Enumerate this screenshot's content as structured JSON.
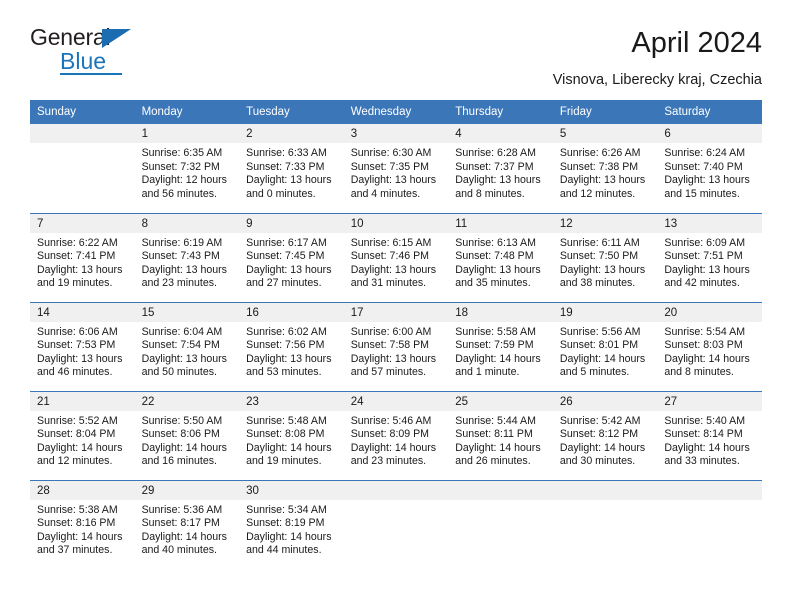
{
  "logo": {
    "text_primary": "General",
    "text_secondary": "Blue",
    "triangle_icon": "blue-triangle-icon",
    "brand_color": "#1b75bb"
  },
  "header": {
    "title": "April 2024",
    "location": "Visnova, Liberecky kraj, Czechia",
    "header_bg_color": "#3b76b8",
    "daynum_bg_color": "#f0f0f0"
  },
  "weekdays": [
    "Sunday",
    "Monday",
    "Tuesday",
    "Wednesday",
    "Thursday",
    "Friday",
    "Saturday"
  ],
  "labels": {
    "sunrise_prefix": "Sunrise:",
    "sunset_prefix": "Sunset:",
    "daylight_prefix": "Daylight:"
  },
  "weeks": [
    [
      {
        "empty": true
      },
      {
        "day": "1",
        "sunrise": "Sunrise: 6:35 AM",
        "sunset": "Sunset: 7:32 PM",
        "daylight_line1": "Daylight: 12 hours",
        "daylight_line2": "and 56 minutes."
      },
      {
        "day": "2",
        "sunrise": "Sunrise: 6:33 AM",
        "sunset": "Sunset: 7:33 PM",
        "daylight_line1": "Daylight: 13 hours",
        "daylight_line2": "and 0 minutes."
      },
      {
        "day": "3",
        "sunrise": "Sunrise: 6:30 AM",
        "sunset": "Sunset: 7:35 PM",
        "daylight_line1": "Daylight: 13 hours",
        "daylight_line2": "and 4 minutes."
      },
      {
        "day": "4",
        "sunrise": "Sunrise: 6:28 AM",
        "sunset": "Sunset: 7:37 PM",
        "daylight_line1": "Daylight: 13 hours",
        "daylight_line2": "and 8 minutes."
      },
      {
        "day": "5",
        "sunrise": "Sunrise: 6:26 AM",
        "sunset": "Sunset: 7:38 PM",
        "daylight_line1": "Daylight: 13 hours",
        "daylight_line2": "and 12 minutes."
      },
      {
        "day": "6",
        "sunrise": "Sunrise: 6:24 AM",
        "sunset": "Sunset: 7:40 PM",
        "daylight_line1": "Daylight: 13 hours",
        "daylight_line2": "and 15 minutes."
      }
    ],
    [
      {
        "day": "7",
        "sunrise": "Sunrise: 6:22 AM",
        "sunset": "Sunset: 7:41 PM",
        "daylight_line1": "Daylight: 13 hours",
        "daylight_line2": "and 19 minutes."
      },
      {
        "day": "8",
        "sunrise": "Sunrise: 6:19 AM",
        "sunset": "Sunset: 7:43 PM",
        "daylight_line1": "Daylight: 13 hours",
        "daylight_line2": "and 23 minutes."
      },
      {
        "day": "9",
        "sunrise": "Sunrise: 6:17 AM",
        "sunset": "Sunset: 7:45 PM",
        "daylight_line1": "Daylight: 13 hours",
        "daylight_line2": "and 27 minutes."
      },
      {
        "day": "10",
        "sunrise": "Sunrise: 6:15 AM",
        "sunset": "Sunset: 7:46 PM",
        "daylight_line1": "Daylight: 13 hours",
        "daylight_line2": "and 31 minutes."
      },
      {
        "day": "11",
        "sunrise": "Sunrise: 6:13 AM",
        "sunset": "Sunset: 7:48 PM",
        "daylight_line1": "Daylight: 13 hours",
        "daylight_line2": "and 35 minutes."
      },
      {
        "day": "12",
        "sunrise": "Sunrise: 6:11 AM",
        "sunset": "Sunset: 7:50 PM",
        "daylight_line1": "Daylight: 13 hours",
        "daylight_line2": "and 38 minutes."
      },
      {
        "day": "13",
        "sunrise": "Sunrise: 6:09 AM",
        "sunset": "Sunset: 7:51 PM",
        "daylight_line1": "Daylight: 13 hours",
        "daylight_line2": "and 42 minutes."
      }
    ],
    [
      {
        "day": "14",
        "sunrise": "Sunrise: 6:06 AM",
        "sunset": "Sunset: 7:53 PM",
        "daylight_line1": "Daylight: 13 hours",
        "daylight_line2": "and 46 minutes."
      },
      {
        "day": "15",
        "sunrise": "Sunrise: 6:04 AM",
        "sunset": "Sunset: 7:54 PM",
        "daylight_line1": "Daylight: 13 hours",
        "daylight_line2": "and 50 minutes."
      },
      {
        "day": "16",
        "sunrise": "Sunrise: 6:02 AM",
        "sunset": "Sunset: 7:56 PM",
        "daylight_line1": "Daylight: 13 hours",
        "daylight_line2": "and 53 minutes."
      },
      {
        "day": "17",
        "sunrise": "Sunrise: 6:00 AM",
        "sunset": "Sunset: 7:58 PM",
        "daylight_line1": "Daylight: 13 hours",
        "daylight_line2": "and 57 minutes."
      },
      {
        "day": "18",
        "sunrise": "Sunrise: 5:58 AM",
        "sunset": "Sunset: 7:59 PM",
        "daylight_line1": "Daylight: 14 hours",
        "daylight_line2": "and 1 minute."
      },
      {
        "day": "19",
        "sunrise": "Sunrise: 5:56 AM",
        "sunset": "Sunset: 8:01 PM",
        "daylight_line1": "Daylight: 14 hours",
        "daylight_line2": "and 5 minutes."
      },
      {
        "day": "20",
        "sunrise": "Sunrise: 5:54 AM",
        "sunset": "Sunset: 8:03 PM",
        "daylight_line1": "Daylight: 14 hours",
        "daylight_line2": "and 8 minutes."
      }
    ],
    [
      {
        "day": "21",
        "sunrise": "Sunrise: 5:52 AM",
        "sunset": "Sunset: 8:04 PM",
        "daylight_line1": "Daylight: 14 hours",
        "daylight_line2": "and 12 minutes."
      },
      {
        "day": "22",
        "sunrise": "Sunrise: 5:50 AM",
        "sunset": "Sunset: 8:06 PM",
        "daylight_line1": "Daylight: 14 hours",
        "daylight_line2": "and 16 minutes."
      },
      {
        "day": "23",
        "sunrise": "Sunrise: 5:48 AM",
        "sunset": "Sunset: 8:08 PM",
        "daylight_line1": "Daylight: 14 hours",
        "daylight_line2": "and 19 minutes."
      },
      {
        "day": "24",
        "sunrise": "Sunrise: 5:46 AM",
        "sunset": "Sunset: 8:09 PM",
        "daylight_line1": "Daylight: 14 hours",
        "daylight_line2": "and 23 minutes."
      },
      {
        "day": "25",
        "sunrise": "Sunrise: 5:44 AM",
        "sunset": "Sunset: 8:11 PM",
        "daylight_line1": "Daylight: 14 hours",
        "daylight_line2": "and 26 minutes."
      },
      {
        "day": "26",
        "sunrise": "Sunrise: 5:42 AM",
        "sunset": "Sunset: 8:12 PM",
        "daylight_line1": "Daylight: 14 hours",
        "daylight_line2": "and 30 minutes."
      },
      {
        "day": "27",
        "sunrise": "Sunrise: 5:40 AM",
        "sunset": "Sunset: 8:14 PM",
        "daylight_line1": "Daylight: 14 hours",
        "daylight_line2": "and 33 minutes."
      }
    ],
    [
      {
        "day": "28",
        "sunrise": "Sunrise: 5:38 AM",
        "sunset": "Sunset: 8:16 PM",
        "daylight_line1": "Daylight: 14 hours",
        "daylight_line2": "and 37 minutes."
      },
      {
        "day": "29",
        "sunrise": "Sunrise: 5:36 AM",
        "sunset": "Sunset: 8:17 PM",
        "daylight_line1": "Daylight: 14 hours",
        "daylight_line2": "and 40 minutes."
      },
      {
        "day": "30",
        "sunrise": "Sunrise: 5:34 AM",
        "sunset": "Sunset: 8:19 PM",
        "daylight_line1": "Daylight: 14 hours",
        "daylight_line2": "and 44 minutes."
      },
      {
        "empty": true
      },
      {
        "empty": true
      },
      {
        "empty": true
      },
      {
        "empty": true
      }
    ]
  ]
}
